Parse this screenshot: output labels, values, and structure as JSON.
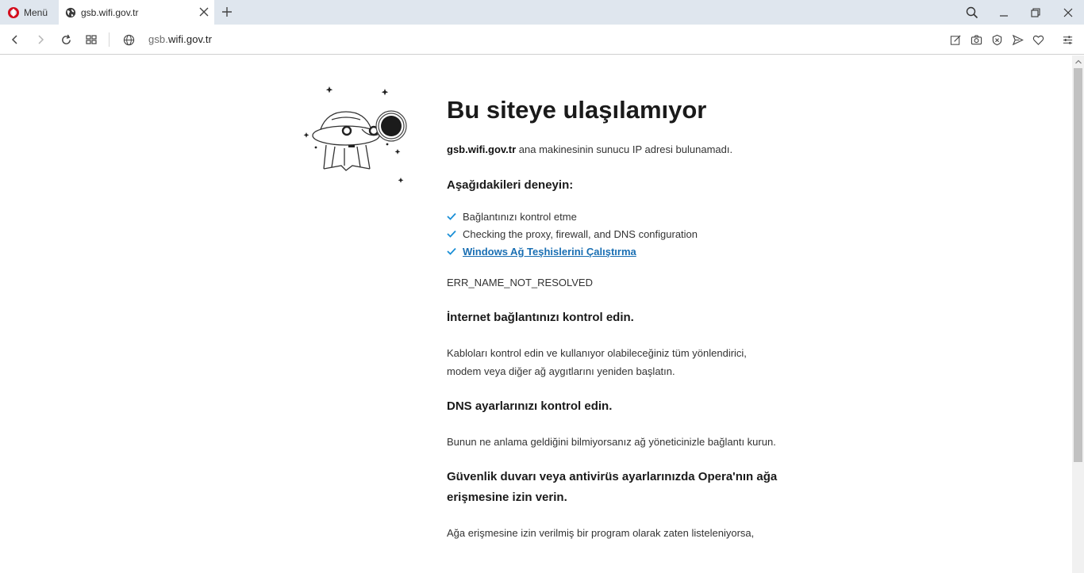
{
  "browser": {
    "menu_label": "Menü",
    "tab_title": "gsb.wifi.gov.tr",
    "url_prefix": "gsb.",
    "url_rest": "wifi.gov.tr",
    "icons": [
      "opera-logo-icon",
      "globe-icon",
      "close-icon",
      "plus-icon",
      "search-icon",
      "minimize-icon",
      "restore-icon",
      "back-icon",
      "forward-icon",
      "reload-icon",
      "tabs-grid-icon",
      "edit-icon",
      "camera-icon",
      "adblock-icon",
      "send-icon",
      "heart-icon",
      "easy-setup-icon"
    ]
  },
  "page": {
    "title": "Bu siteye ulaşılamıyor",
    "host_bold": "gsb.wifi.gov.tr",
    "host_message": " ana makinesinin sunucu IP adresi bulunamadı.",
    "try_heading": "Aşağıdakileri deneyin:",
    "checks": [
      {
        "text": "Bağlantınızı kontrol etme",
        "link": false
      },
      {
        "text": "Checking the proxy, firewall, and DNS configuration",
        "link": false
      },
      {
        "text": "Windows Ağ Teşhislerini Çalıştırma",
        "link": true
      }
    ],
    "error_code": "ERR_NAME_NOT_RESOLVED",
    "section1_heading": "İnternet bağlantınızı kontrol edin.",
    "section1_body": "Kabloları kontrol edin ve kullanıyor olabileceğiniz tüm yönlendirici, modem veya diğer ağ aygıtlarını yeniden başlatın.",
    "section2_heading": "DNS ayarlarınızı kontrol edin.",
    "section2_body": "Bunun ne anlama geldiğini bilmiyorsanız ağ yöneticinizle bağlantı kurun.",
    "section3_heading": "Güvenlik duvarı veya antivirüs ayarlarınızda Opera'nın ağa erişmesine izin verin.",
    "section3_body": "Ağa erişmesine izin verilmiş bir program olarak zaten listeleniyorsa,"
  },
  "colors": {
    "accent_link": "#1a6fb3",
    "check": "#1a8fd6",
    "opera_red": "#d40e1d",
    "tabstrip": "#dfe6ee"
  }
}
